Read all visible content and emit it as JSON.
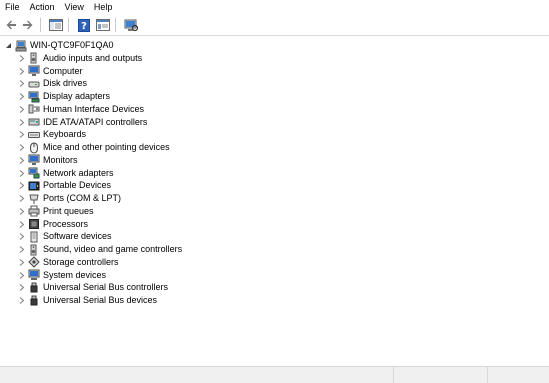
{
  "menu": [
    "File",
    "Action",
    "View",
    "Help"
  ],
  "toolbar": {
    "buttons": [
      "back-icon",
      "forward-icon",
      "show-hide-tree-icon",
      "help-icon",
      "properties-icon",
      "scan-hardware-icon"
    ]
  },
  "tree": {
    "root": {
      "label": "WIN-QTC9F0F1QA0",
      "icon": "computer-network-icon",
      "expanded": true
    },
    "categories": [
      {
        "label": "Audio inputs and outputs",
        "icon": "speaker-icon"
      },
      {
        "label": "Computer",
        "icon": "monitor-icon"
      },
      {
        "label": "Disk drives",
        "icon": "disk-drive-icon"
      },
      {
        "label": "Display adapters",
        "icon": "display-adapter-icon"
      },
      {
        "label": "Human Interface Devices",
        "icon": "hid-icon"
      },
      {
        "label": "IDE ATA/ATAPI controllers",
        "icon": "ide-controller-icon"
      },
      {
        "label": "Keyboards",
        "icon": "keyboard-icon"
      },
      {
        "label": "Mice and other pointing devices",
        "icon": "mouse-icon"
      },
      {
        "label": "Monitors",
        "icon": "monitor-icon"
      },
      {
        "label": "Network adapters",
        "icon": "network-adapter-icon"
      },
      {
        "label": "Portable Devices",
        "icon": "portable-device-icon"
      },
      {
        "label": "Ports (COM & LPT)",
        "icon": "port-icon"
      },
      {
        "label": "Print queues",
        "icon": "printer-icon"
      },
      {
        "label": "Processors",
        "icon": "processor-icon"
      },
      {
        "label": "Software devices",
        "icon": "software-device-icon"
      },
      {
        "label": "Sound, video and game controllers",
        "icon": "speaker-icon"
      },
      {
        "label": "Storage controllers",
        "icon": "storage-controller-icon"
      },
      {
        "label": "System devices",
        "icon": "system-device-icon"
      },
      {
        "label": "Universal Serial Bus controllers",
        "icon": "usb-icon"
      },
      {
        "label": "Universal Serial Bus devices",
        "icon": "usb-icon"
      }
    ]
  }
}
